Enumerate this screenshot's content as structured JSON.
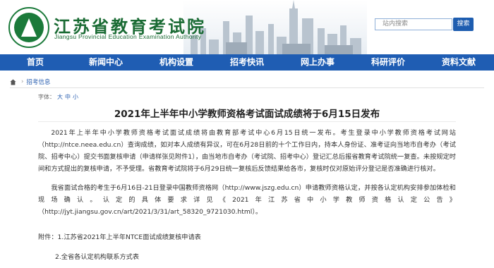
{
  "header": {
    "title": "江苏省教育考试院",
    "subtitle": "Jiangsu Provincial Education Examination Authority",
    "search_placeholder": "站内搜索",
    "search_button": "搜索"
  },
  "nav": {
    "items": [
      "首页",
      "新闻中心",
      "机构设置",
      "招考快讯",
      "网上办事",
      "科研评价",
      "资料文献"
    ]
  },
  "breadcrumb": {
    "current": "招考信息"
  },
  "font_size": {
    "label": "字体：",
    "large": "大",
    "medium": "中",
    "small": "小"
  },
  "article": {
    "title": "2021年上半年中小学教师资格考试面试成绩将于6月15日发布",
    "para1": "2021年上半年中小学教师资格考试面试成绩将由教育部考试中心6月15日统一发布。考生登录中小学教师资格考试网站（http://ntce.neea.edu.cn）查询成绩，如对本人成绩有异议，可在6月28日前的十个工作日内，持本人身份证、准考证向当地市自考办（考试院、招考中心）提交书面复核申请（申请样张见附件1），由当地市自考办（考试院、招考中心）登记汇总后报省教育考试院统一复查。未按规定时间和方式提出的复核申请，不予受理。省教育考试院将于6月29日统一复核后反馈结果给各市，复核时仅对原始评分登记是否准确进行核对。",
    "para2": "我省面试合格的考生于6月16日-21日登录中国教师资格网（http://www.jszg.edu.cn）申请教师资格认定，并按各认定机构安排参加体检和现场确认。认定的具体要求详见《2021年江苏省中小学教师资格认定公告》（http://jyt.jiangsu.gov.cn/art/2021/3/31/art_58320_9721030.html）。",
    "attachment1": "附件：1.江苏省2021年上半年NTCE面试成绩复核申请表",
    "attachment2": "2.全省各认定机构联系方式表"
  },
  "colors": {
    "nav_bg": "#1f5db3",
    "brand_green": "#1a6b34",
    "link": "#2a5fb0"
  }
}
